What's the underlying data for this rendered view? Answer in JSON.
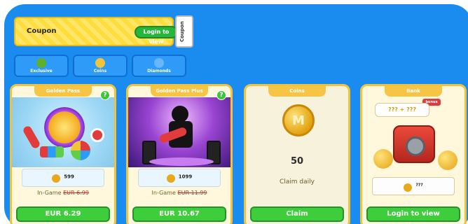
{
  "coupon": {
    "label": "Coupon",
    "button": "Login to view",
    "tab": "Coupon"
  },
  "categories": [
    {
      "label": "Exclusive",
      "icon": "exclusive-icon",
      "color": "#5fae2e"
    },
    {
      "label": "Coins",
      "icon": "coin-icon",
      "color": "#f3c43a"
    },
    {
      "label": "Diamonds",
      "icon": "diamond-icon",
      "color": "#69b6ff"
    }
  ],
  "cards": [
    {
      "title": "Golden Pass",
      "help": "?",
      "amount": "599",
      "ingame_prefix": "In-Game",
      "ingame_price": "EUR 6.99",
      "button": "EUR 6.29"
    },
    {
      "title": "Golden Pass Plus",
      "help": "?",
      "amount": "1099",
      "ingame_prefix": "In-Game",
      "ingame_price": "EUR 11.99",
      "button": "EUR 10.67"
    },
    {
      "title": "Coins",
      "amount": "50",
      "subtitle": "Claim daily",
      "button": "Claim"
    },
    {
      "title": "Bank",
      "bonus": "bonus",
      "bubble": "??? + ???",
      "amount": "???",
      "button": "Login to view"
    }
  ],
  "colors": {
    "background": "#1a8cf0",
    "button_green": "#3fce3b",
    "card_border": "#f2c33a"
  }
}
